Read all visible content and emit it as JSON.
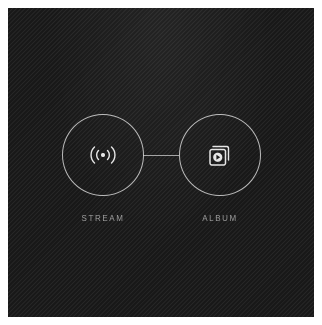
{
  "options": [
    {
      "id": "stream",
      "label": "STREAM",
      "icon": "broadcast-signal-icon"
    },
    {
      "id": "album",
      "label": "ALBUM",
      "icon": "photo-album-play-icon"
    }
  ],
  "colors": {
    "background": "#1c1c1c",
    "outline": "#d7d7d7",
    "label": "#9e9e9e"
  }
}
